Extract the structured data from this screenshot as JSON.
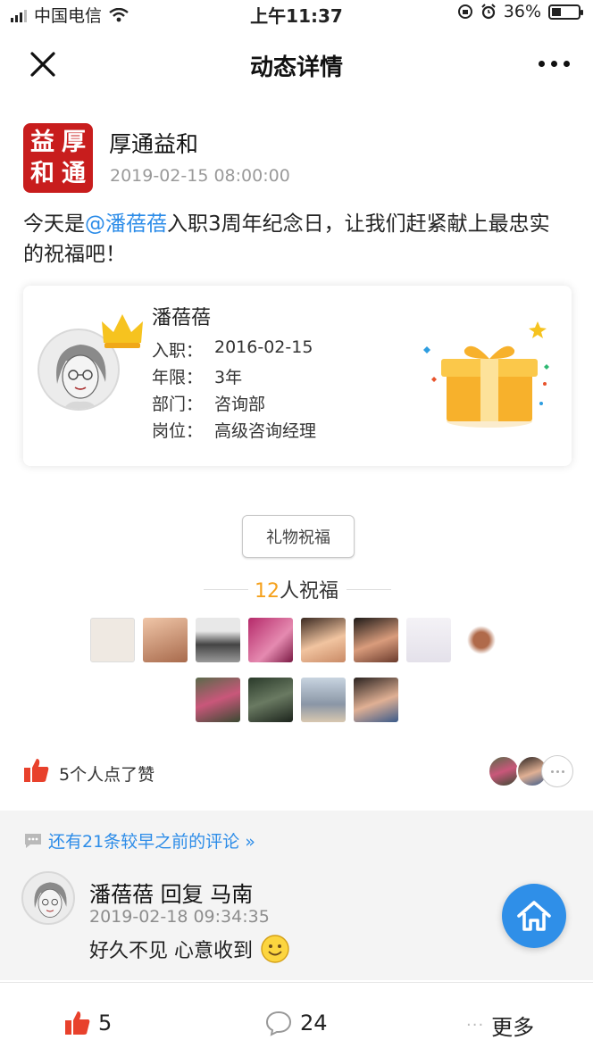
{
  "status_bar": {
    "carrier": "中国电信",
    "time": "上午11:37",
    "battery": "36%",
    "battery_level": 0.36
  },
  "nav": {
    "title": "动态详情"
  },
  "post": {
    "author": "厚通益和",
    "seal_chars": [
      "益",
      "厚",
      "和",
      "通"
    ],
    "time": "2019-02-15 08:00:00",
    "text_before": "今天是",
    "mention": "@潘蓓蓓",
    "text_after": "入职3周年纪念日，让我们赶紧献上最忠实的祝福吧！"
  },
  "card": {
    "name": "潘蓓蓓",
    "rows": [
      {
        "key": "入职：",
        "value": "2016-02-15"
      },
      {
        "key": "年限：",
        "value": "3年"
      },
      {
        "key": "部门：",
        "value": "咨询部"
      },
      {
        "key": "岗位：",
        "value": "高级咨询经理"
      }
    ]
  },
  "gift_button": {
    "label": "礼物祝福"
  },
  "blessings": {
    "count": "12",
    "label": "人祝福"
  },
  "likes": {
    "text": "5个人点了赞"
  },
  "comments": {
    "earlier_link": "还有21条较早之前的评论 »",
    "items": [
      {
        "author": "潘蓓蓓",
        "reply_word": "回复",
        "reply_to": "马南",
        "time": "2019-02-18 09:34:35",
        "body": "好久不见 心意收到"
      }
    ]
  },
  "bottom_bar": {
    "like_count": "5",
    "comment_count": "24",
    "more_label": "更多"
  },
  "colors": {
    "accent_blue": "#2c8ce8",
    "like_red": "#e8412c",
    "count_orange": "#f5a11c",
    "seal_red": "#c81d1d"
  }
}
